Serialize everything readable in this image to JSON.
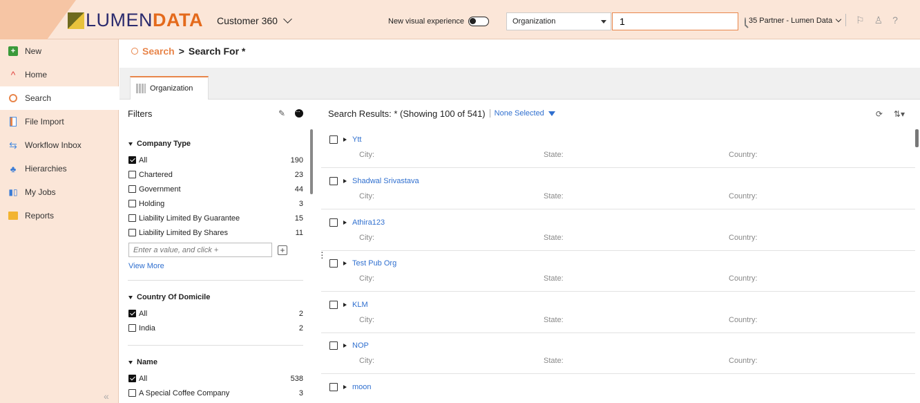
{
  "header": {
    "logo_part1": "LUMEN",
    "logo_part2": "DATA",
    "app_name": "Customer 360",
    "new_visual_label": "New visual experience",
    "entity_select": "Organization",
    "search_value": "1",
    "tenant": "35 Partner - Lumen Data",
    "icons": [
      "flag-icon",
      "user-icon",
      "help-icon"
    ]
  },
  "sidebar": {
    "items": [
      {
        "label": "New",
        "icon": "plus-icon"
      },
      {
        "label": "Home",
        "icon": "home-icon"
      },
      {
        "label": "Search",
        "icon": "search-icon",
        "active": true
      },
      {
        "label": "File Import",
        "icon": "file-import-icon"
      },
      {
        "label": "Workflow Inbox",
        "icon": "workflow-icon"
      },
      {
        "label": "Hierarchies",
        "icon": "hierarchy-icon"
      },
      {
        "label": "My Jobs",
        "icon": "jobs-icon"
      },
      {
        "label": "Reports",
        "icon": "folder-icon"
      }
    ],
    "collapse": "«"
  },
  "breadcrumb": {
    "root": "Search",
    "separator": ">",
    "current": "Search For *"
  },
  "tab": {
    "label": "Organization"
  },
  "filters": {
    "title": "Filters",
    "company_type": {
      "title": "Company Type",
      "options": [
        {
          "label": "All",
          "count": "190",
          "checked": true
        },
        {
          "label": "Chartered",
          "count": "23",
          "checked": false
        },
        {
          "label": "Government",
          "count": "44",
          "checked": false
        },
        {
          "label": "Holding",
          "count": "3",
          "checked": false
        },
        {
          "label": "Liability Limited By Guarantee",
          "count": "15",
          "checked": false
        },
        {
          "label": "Liability Limited By Shares",
          "count": "11",
          "checked": false
        }
      ],
      "input_placeholder": "Enter a value, and click +",
      "view_more": "View More"
    },
    "country": {
      "title": "Country Of Domicile",
      "options": [
        {
          "label": "All",
          "count": "2",
          "checked": true
        },
        {
          "label": "India",
          "count": "2",
          "checked": false
        }
      ]
    },
    "name": {
      "title": "Name",
      "options": [
        {
          "label": "All",
          "count": "538",
          "checked": true
        },
        {
          "label": "A Special Coffee Company",
          "count": "3",
          "checked": false
        }
      ]
    }
  },
  "results": {
    "summary": "Search Results: * (Showing 100 of 541)",
    "selection": "None Selected",
    "field_city": "City:",
    "field_state": "State:",
    "field_country": "Country:",
    "items": [
      {
        "name": "Ytt"
      },
      {
        "name": "Shadwal Srivastava"
      },
      {
        "name": "Athira123"
      },
      {
        "name": "Test Pub Org"
      },
      {
        "name": "KLM"
      },
      {
        "name": "NOP"
      },
      {
        "name": "moon"
      }
    ]
  },
  "colors": {
    "accent": "#e8854a",
    "link": "#2f6fcf",
    "sidebar_bg": "#fbe6d8"
  }
}
